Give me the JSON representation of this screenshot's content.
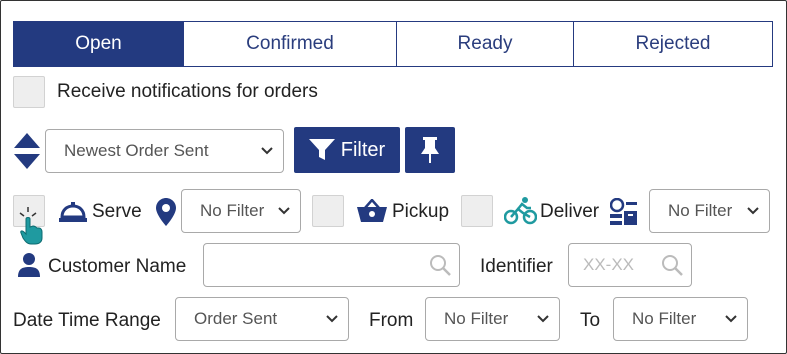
{
  "tabs": [
    {
      "label": "Open",
      "active": true
    },
    {
      "label": "Confirmed",
      "active": false
    },
    {
      "label": "Ready",
      "active": false
    },
    {
      "label": "Rejected",
      "active": false
    }
  ],
  "notifications": {
    "label": "Receive notifications for orders",
    "checked": false
  },
  "sort": {
    "selected": "Newest Order Sent"
  },
  "filter_button": {
    "label": "Filter"
  },
  "service": {
    "serve_label": "Serve",
    "serve_checked": false,
    "location_select": "No Filter",
    "pickup_label": "Pickup",
    "pickup_checked": false,
    "deliver_label": "Deliver",
    "deliver_checked": false,
    "type_select": "No Filter"
  },
  "customer": {
    "label": "Customer Name",
    "value": ""
  },
  "identifier": {
    "label": "Identifier",
    "placeholder": "XX-XX"
  },
  "date_range": {
    "label": "Date Time Range",
    "selected": "Order Sent",
    "from_label": "From",
    "from_selected": "No Filter",
    "to_label": "To",
    "to_selected": "No Filter"
  },
  "colors": {
    "primary": "#233a80",
    "accent_teal": "#1f9aa0"
  }
}
